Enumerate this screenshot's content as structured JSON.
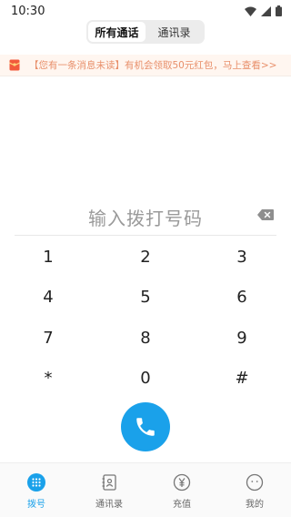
{
  "status_bar": {
    "time": "10:30"
  },
  "segment": {
    "tabs": [
      {
        "label": "所有通话",
        "active": true
      },
      {
        "label": "通讯录",
        "active": false
      }
    ]
  },
  "promo": {
    "text": "【您有一条消息未读】有机会领取50元红包，马上查看>>",
    "icon": "red-envelope-icon"
  },
  "dialer": {
    "placeholder": "输入拨打号码",
    "keys": [
      "1",
      "2",
      "3",
      "4",
      "5",
      "6",
      "7",
      "8",
      "9",
      "*",
      "0",
      "#"
    ]
  },
  "tabbar": {
    "items": [
      {
        "label": "拨号",
        "icon": "dialpad-icon",
        "active": true
      },
      {
        "label": "通讯录",
        "icon": "contacts-icon",
        "active": false
      },
      {
        "label": "充值",
        "icon": "yen-icon",
        "active": false
      },
      {
        "label": "我的",
        "icon": "profile-icon",
        "active": false
      }
    ]
  },
  "colors": {
    "accent": "#1aa1ea",
    "promo_text": "#e88f6a",
    "placeholder": "#9a9a9a"
  }
}
